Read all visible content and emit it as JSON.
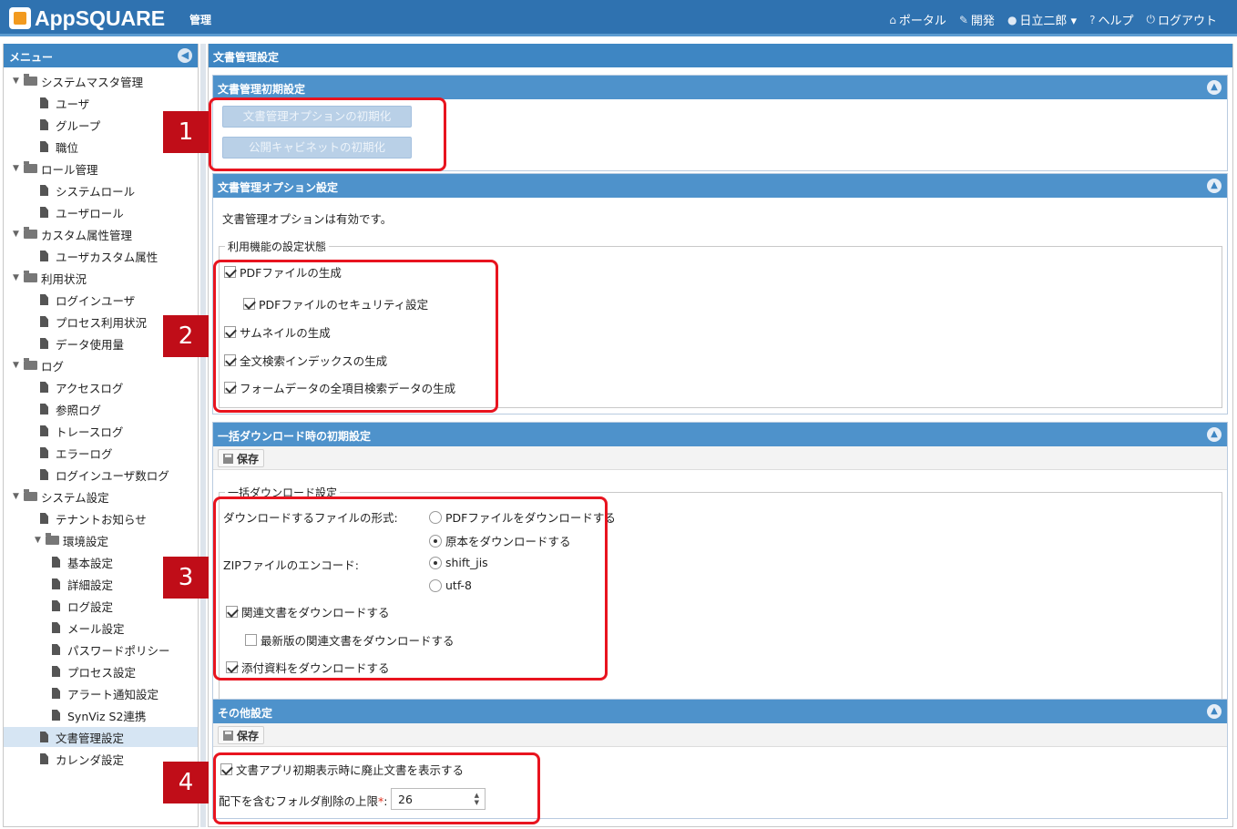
{
  "header": {
    "logo": "AppSQUARE",
    "app_title": "管理",
    "nav": [
      {
        "icon": "home-icon",
        "label": "ポータル"
      },
      {
        "icon": "wrench-icon",
        "label": "開発"
      },
      {
        "icon": "user-icon",
        "label": "日立二郎 ▾"
      },
      {
        "icon": "help-icon",
        "label": "ヘルプ"
      },
      {
        "icon": "power-icon",
        "label": "ログアウト"
      }
    ]
  },
  "sidebar": {
    "title": "メニュー",
    "tree": [
      {
        "label": "システムマスタ管理",
        "type": "folder",
        "level": 0
      },
      {
        "label": "ユーザ",
        "type": "file",
        "level": 1
      },
      {
        "label": "グループ",
        "type": "file",
        "level": 1
      },
      {
        "label": "職位",
        "type": "file",
        "level": 1
      },
      {
        "label": "ロール管理",
        "type": "folder",
        "level": 0
      },
      {
        "label": "システムロール",
        "type": "file",
        "level": 1
      },
      {
        "label": "ユーザロール",
        "type": "file",
        "level": 1
      },
      {
        "label": "カスタム属性管理",
        "type": "folder",
        "level": 0
      },
      {
        "label": "ユーザカスタム属性",
        "type": "file",
        "level": 1
      },
      {
        "label": "利用状況",
        "type": "folder",
        "level": 0
      },
      {
        "label": "ログインユーザ",
        "type": "file",
        "level": 1
      },
      {
        "label": "プロセス利用状況",
        "type": "file",
        "level": 1
      },
      {
        "label": "データ使用量",
        "type": "file",
        "level": 1
      },
      {
        "label": "ログ",
        "type": "folder",
        "level": 0
      },
      {
        "label": "アクセスログ",
        "type": "file",
        "level": 1
      },
      {
        "label": "参照ログ",
        "type": "file",
        "level": 1
      },
      {
        "label": "トレースログ",
        "type": "file",
        "level": 1
      },
      {
        "label": "エラーログ",
        "type": "file",
        "level": 1
      },
      {
        "label": "ログインユーザ数ログ",
        "type": "file",
        "level": 1
      },
      {
        "label": "システム設定",
        "type": "folder",
        "level": 0
      },
      {
        "label": "テナントお知らせ",
        "type": "file",
        "level": 1
      },
      {
        "label": "環境設定",
        "type": "folder",
        "level": 1
      },
      {
        "label": "基本設定",
        "type": "file",
        "level": 2
      },
      {
        "label": "詳細設定",
        "type": "file",
        "level": 2
      },
      {
        "label": "ログ設定",
        "type": "file",
        "level": 2
      },
      {
        "label": "メール設定",
        "type": "file",
        "level": 2
      },
      {
        "label": "パスワードポリシー",
        "type": "file",
        "level": 2
      },
      {
        "label": "プロセス設定",
        "type": "file",
        "level": 2
      },
      {
        "label": "アラート通知設定",
        "type": "file",
        "level": 2
      },
      {
        "label": "SynViz S2連携",
        "type": "file",
        "level": 2
      },
      {
        "label": "文書管理設定",
        "type": "file",
        "level": 1,
        "selected": true
      },
      {
        "label": "カレンダ設定",
        "type": "file",
        "level": 1
      }
    ]
  },
  "main": {
    "title": "文書管理設定",
    "init_panel": {
      "title": "文書管理初期設定",
      "buttons": [
        "文書管理オプションの初期化",
        "公開キャビネットの初期化"
      ]
    },
    "option_panel": {
      "title": "文書管理オプション設定",
      "status": "文書管理オプションは有効です。",
      "fieldset_legend": "利用機能の設定状態",
      "items": [
        {
          "label": "PDFファイルの生成",
          "checked": true
        },
        {
          "label": "PDFファイルのセキュリティ設定",
          "checked": true
        },
        {
          "label": "サムネイルの生成",
          "checked": true
        },
        {
          "label": "全文検索インデックスの生成",
          "checked": true
        },
        {
          "label": "フォームデータの全項目検索データの生成",
          "checked": true
        }
      ]
    },
    "download_panel": {
      "title": "一括ダウンロード時の初期設定",
      "save_label": "保存",
      "fieldset_legend": "一括ダウンロード設定",
      "format_label": "ダウンロードするファイルの形式:",
      "format_options": [
        {
          "label": "PDFファイルをダウンロードする",
          "selected": false
        },
        {
          "label": "原本をダウンロードする",
          "selected": true
        }
      ],
      "encode_label": "ZIPファイルのエンコード:",
      "encode_options": [
        {
          "label": "shift_jis",
          "selected": true
        },
        {
          "label": "utf-8",
          "selected": false
        }
      ],
      "checks": [
        {
          "label": "関連文書をダウンロードする",
          "checked": true
        },
        {
          "label": "最新版の関連文書をダウンロードする",
          "checked": false
        },
        {
          "label": "添付資料をダウンロードする",
          "checked": true
        }
      ]
    },
    "other_panel": {
      "title": "その他設定",
      "save_label": "保存",
      "show_obsolete_label": "文書アプリ初期表示時に廃止文書を表示する",
      "show_obsolete_checked": true,
      "folder_limit_label": "配下を含むフォルダ削除の上限",
      "required_mark": "*",
      "folder_limit_value": "26"
    }
  },
  "callouts": [
    "1",
    "2",
    "3",
    "4"
  ],
  "colors": {
    "header": "#2f72b0",
    "panel_header": "#4e92cb",
    "callout": "#e8141f",
    "badge": "#c00d18"
  }
}
